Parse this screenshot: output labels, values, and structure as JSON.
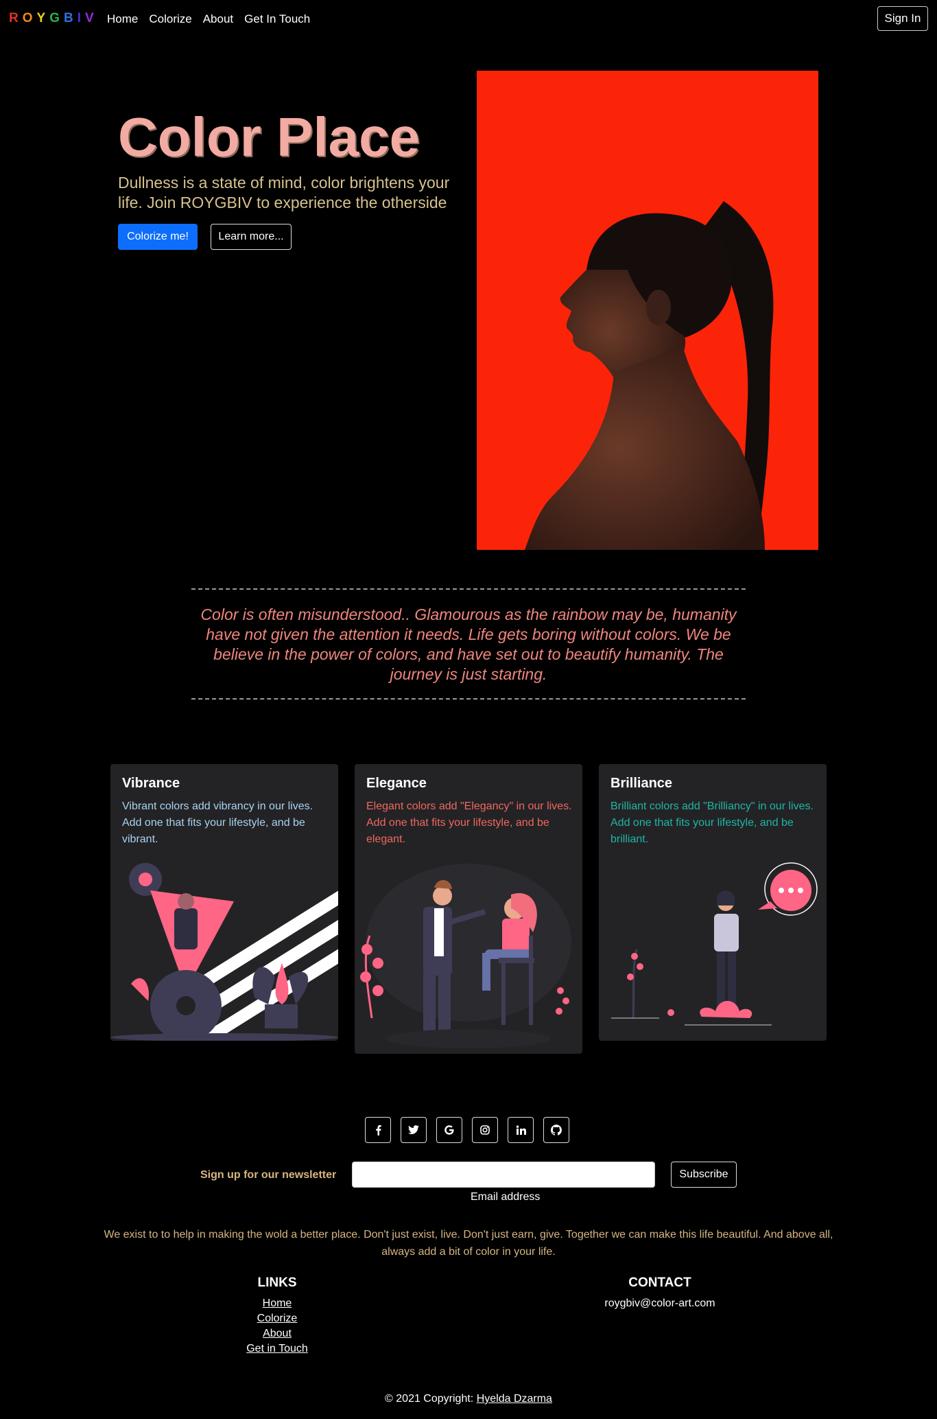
{
  "nav": {
    "brand_letters": [
      {
        "char": "R",
        "color": "#e0312b"
      },
      {
        "char": "O",
        "color": "#f08a1c"
      },
      {
        "char": "Y",
        "color": "#f4d11c"
      },
      {
        "char": "G",
        "color": "#28b34b"
      },
      {
        "char": "B",
        "color": "#2f6fe0"
      },
      {
        "char": "I",
        "color": "#4b2fd1"
      },
      {
        "char": "V",
        "color": "#8f2fe0"
      }
    ],
    "links": [
      "Home",
      "Colorize",
      "About",
      "Get In Touch"
    ],
    "signin_label": "Sign In"
  },
  "hero": {
    "title": "Color Place",
    "subtitle": "Dullness is a state of mind, color brightens your life. Join ROYGBIV to experience the otherside",
    "primary_label": "Colorize me!",
    "secondary_label": "Learn more...",
    "image_bg": "#fb2409"
  },
  "quote": "Color is often misunderstood.. Glamourous as the rainbow may be, humanity have not given the attention it needs. Life gets boring without colors. We be believe in the power of colors, and have set out to beautify humanity. The journey is just starting.",
  "cards": [
    {
      "title": "Vibrance",
      "text": "Vibrant colors add vibrancy in our lives. Add one that fits your lifestyle, and be vibrant.",
      "text_color": "#a9d3f0"
    },
    {
      "title": "Elegance",
      "text": "Elegant colors add \"Elegancy\" in our lives. Add one that fits your lifestyle, and be elegant.",
      "text_color": "#f0675f"
    },
    {
      "title": "Brilliance",
      "text": "Brilliant colors add \"Brilliancy\" in our lives. Add one that fits your lifestyle, and be brilliant.",
      "text_color": "#1fb6a6"
    }
  ],
  "social_icons": [
    "facebook-icon",
    "twitter-icon",
    "google-icon",
    "instagram-icon",
    "linkedin-icon",
    "github-icon"
  ],
  "newsletter": {
    "label": "Sign up for our newsletter",
    "email_label": "Email address",
    "subscribe_label": "Subscribe"
  },
  "mission": "We exist to to help in making the wold a better place. Don't just exist, live. Don't just earn, give. Together we can make this life beautiful. And above all, always add a bit of color in your life.",
  "footer": {
    "links_title": "LINKS",
    "links": [
      "Home",
      "Colorize",
      "About",
      "Get in Touch"
    ],
    "contact_title": "CONTACT",
    "contact_email": "roygbiv@color-art.com",
    "copyright_prefix": "© 2021 Copyright:",
    "copyright_name": "Hyelda Dzarma"
  }
}
